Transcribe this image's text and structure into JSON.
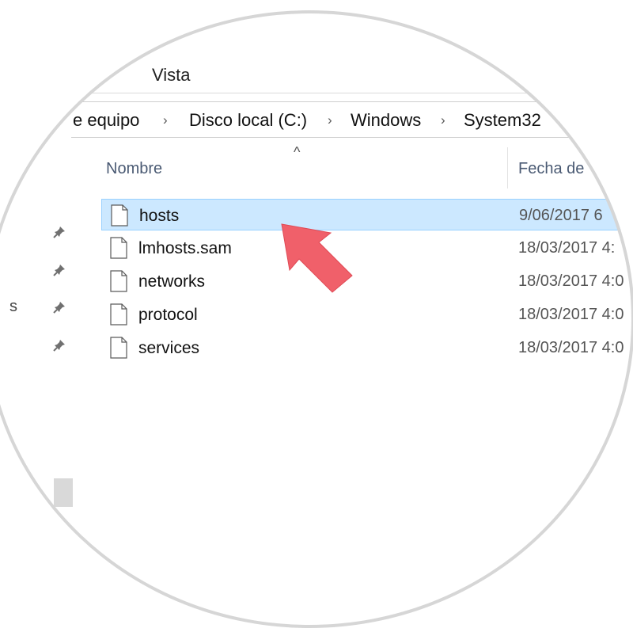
{
  "ribbon": {
    "tab_view": "Vista"
  },
  "breadcrumb": {
    "items": [
      "e equipo",
      "Disco local (C:)",
      "Windows",
      "System32"
    ],
    "separator": "›"
  },
  "columns": {
    "name": "Nombre",
    "date": "Fecha de"
  },
  "sort_indicator": "^",
  "files": [
    {
      "name": "hosts",
      "date": "9/06/2017 6",
      "selected": true
    },
    {
      "name": "lmhosts.sam",
      "date": "18/03/2017 4:",
      "selected": false
    },
    {
      "name": "networks",
      "date": "18/03/2017 4:0",
      "selected": false
    },
    {
      "name": "protocol",
      "date": "18/03/2017 4:0",
      "selected": false
    },
    {
      "name": "services",
      "date": "18/03/2017 4:0",
      "selected": false
    }
  ],
  "left_edge_text": "s",
  "colors": {
    "selection_bg": "#cce8ff",
    "selection_border": "#99d1ff",
    "arrow": "#f0606a",
    "column_header": "#4a5a73"
  },
  "icons": [
    "pin-icon",
    "file-icon",
    "pointer-arrow-icon",
    "chevron-right-icon"
  ]
}
